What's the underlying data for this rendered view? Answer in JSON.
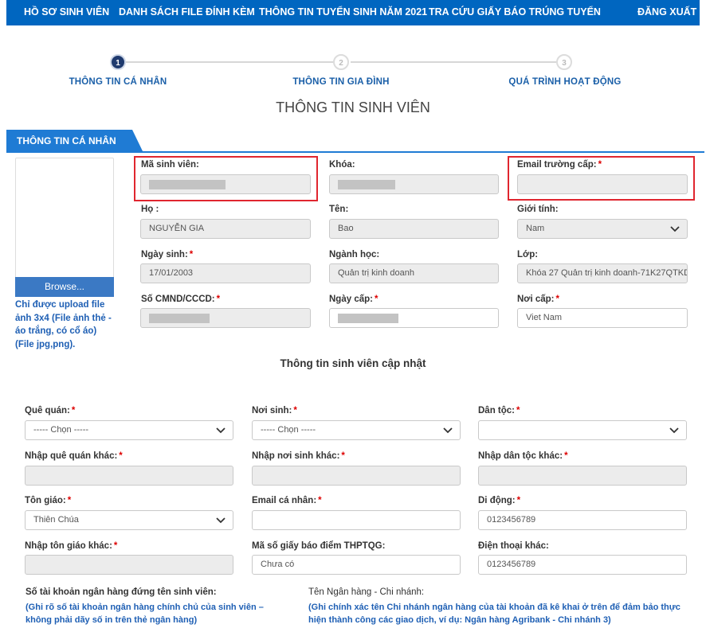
{
  "nav": {
    "items": [
      "HỒ SƠ SINH VIÊN",
      "DANH SÁCH FILE ĐÍNH KÈM",
      "THÔNG TIN TUYỂN SINH NĂM 2021",
      "TRA CỨU GIẤY BÁO TRÚNG TUYỂN"
    ],
    "logout": "ĐĂNG XUẤT"
  },
  "stepper": {
    "steps": [
      {
        "number": "1",
        "label": "THÔNG TIN CÁ NHÂN",
        "active": true
      },
      {
        "number": "2",
        "label": "THÔNG TIN GIA ĐÌNH",
        "active": false
      },
      {
        "number": "3",
        "label": "QUÁ TRÌNH HOẠT ĐỘNG",
        "active": false
      }
    ]
  },
  "page_title": "THÔNG TIN SINH VIÊN",
  "section_tab": "THÔNG TIN CÁ NHÂN",
  "photo": {
    "browse_label": "Browse...",
    "note": "Chỉ được upload file ảnh 3x4 (File ảnh thẻ - áo trắng, có cổ áo) (File jpg,png)."
  },
  "personal": {
    "ma_sv": {
      "label": "Mã sinh viên:",
      "value": ""
    },
    "khoa": {
      "label": "Khóa:",
      "value": ""
    },
    "email_truong": {
      "label": "Email trường cấp:",
      "required": "*",
      "value": ""
    },
    "ho": {
      "label": "Họ :",
      "value": "NGUYỄN GIA"
    },
    "ten": {
      "label": "Tên:",
      "value": "Bao"
    },
    "gioi_tinh": {
      "label": "Giới tính:",
      "value": "Nam"
    },
    "ngay_sinh": {
      "label": "Ngày sinh:",
      "required": "*",
      "value": "17/01/2003"
    },
    "nganh_hoc": {
      "label": "Ngành học:",
      "value": "Quản trị kinh doanh"
    },
    "lop": {
      "label": "Lớp:",
      "value": "Khóa 27 Quản trị kinh doanh-71K27QTKD"
    },
    "cmnd": {
      "label": "Số CMND/CCCD:",
      "required": "*",
      "value": ""
    },
    "ngay_cap": {
      "label": "Ngày cấp:",
      "required": "*",
      "value": ""
    },
    "noi_cap": {
      "label": "Nơi cấp:",
      "required": "*",
      "value": "Viet Nam"
    }
  },
  "update_title": "Thông tin sinh viên cập nhật",
  "update": {
    "que_quan": {
      "label": "Quê quán:",
      "required": "*",
      "value": "----- Chọn -----"
    },
    "noi_sinh": {
      "label": "Nơi sinh:",
      "required": "*",
      "value": "----- Chọn -----"
    },
    "dan_toc": {
      "label": "Dân tộc:",
      "required": "*",
      "value": ""
    },
    "que_quan_khac": {
      "label": "Nhập quê quán khác:",
      "required": "*",
      "value": ""
    },
    "noi_sinh_khac": {
      "label": "Nhập nơi sinh khác:",
      "required": "*",
      "value": ""
    },
    "dan_toc_khac": {
      "label": "Nhập dân tộc khác:",
      "required": "*",
      "value": ""
    },
    "ton_giao": {
      "label": "Tôn giáo:",
      "required": "*",
      "value": "Thiên Chúa"
    },
    "email_ca_nhan": {
      "label": "Email cá nhân:",
      "required": "*",
      "value": ""
    },
    "di_dong": {
      "label": "Di động:",
      "required": "*",
      "value": "0123456789"
    },
    "ton_giao_khac": {
      "label": "Nhập tôn giáo khác:",
      "required": "*",
      "value": ""
    },
    "ma_giay_bao": {
      "label": "Mã số giấy báo điểm THPTQG:",
      "value": "Chưa có"
    },
    "dien_thoai_khac": {
      "label": "Điện thoại khác:",
      "value": "0123456789"
    }
  },
  "bank": {
    "account_label": "Số tài khoản ngân hàng đứng tên sinh viên:",
    "account_note": "(Ghi rõ số tài khoản ngân hàng chính chủ của sinh viên – không phải dãy số in trên thẻ ngân hàng)",
    "branch_label": "Tên Ngân hàng - Chi nhánh:",
    "branch_note": "(Ghi chính xác tên Chi nhánh ngân hàng của tài khoản đã kê khai ở trên để đảm bảo thực hiện thành công các giao dịch, ví dụ: Ngân hàng Agribank - Chi nhánh 3)"
  },
  "colors": {
    "nav_bg": "#0066c0",
    "accent": "#1f7bd4",
    "highlight": "#e0262f",
    "required": "#dd0000"
  }
}
